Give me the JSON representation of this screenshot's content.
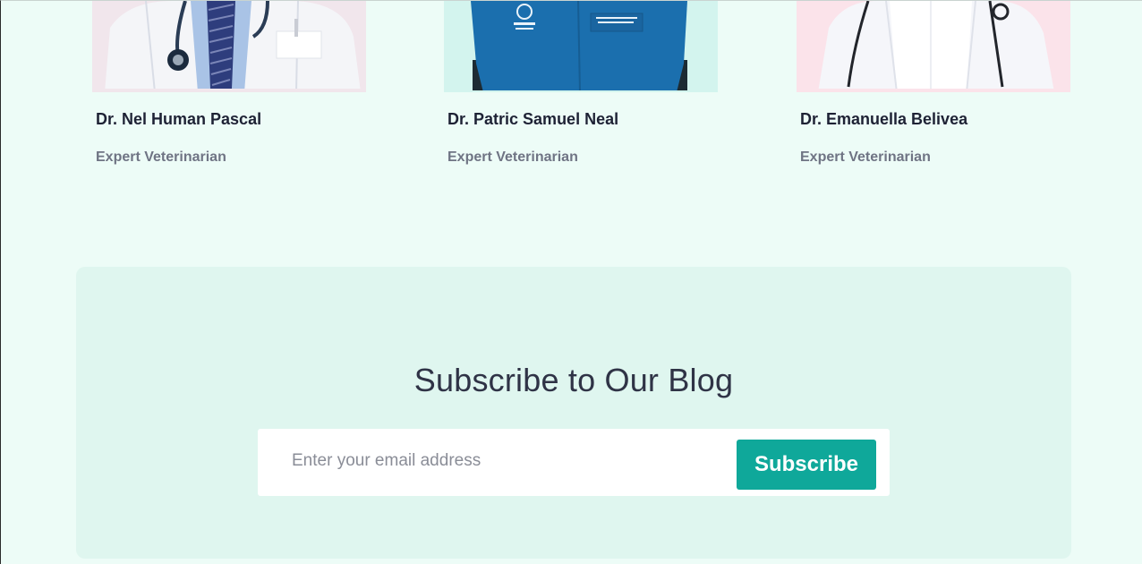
{
  "team": {
    "members": [
      {
        "name": "Dr. Nel Human Pascal",
        "role": "Expert Veterinarian"
      },
      {
        "name": "Dr. Patric Samuel Neal",
        "role": "Expert Veterinarian"
      },
      {
        "name": "Dr. Emanuella Belivea",
        "role": "Expert Veterinarian"
      }
    ]
  },
  "subscribe": {
    "title": "Subscribe to Our Blog",
    "email_placeholder": "Enter your email address",
    "button_label": "Subscribe"
  },
  "colors": {
    "accent": "#0fa89a",
    "page_background": "#edfcf7",
    "section_background": "#dff6ef",
    "heading_text": "#1e2235",
    "muted_text": "#6f7484"
  }
}
